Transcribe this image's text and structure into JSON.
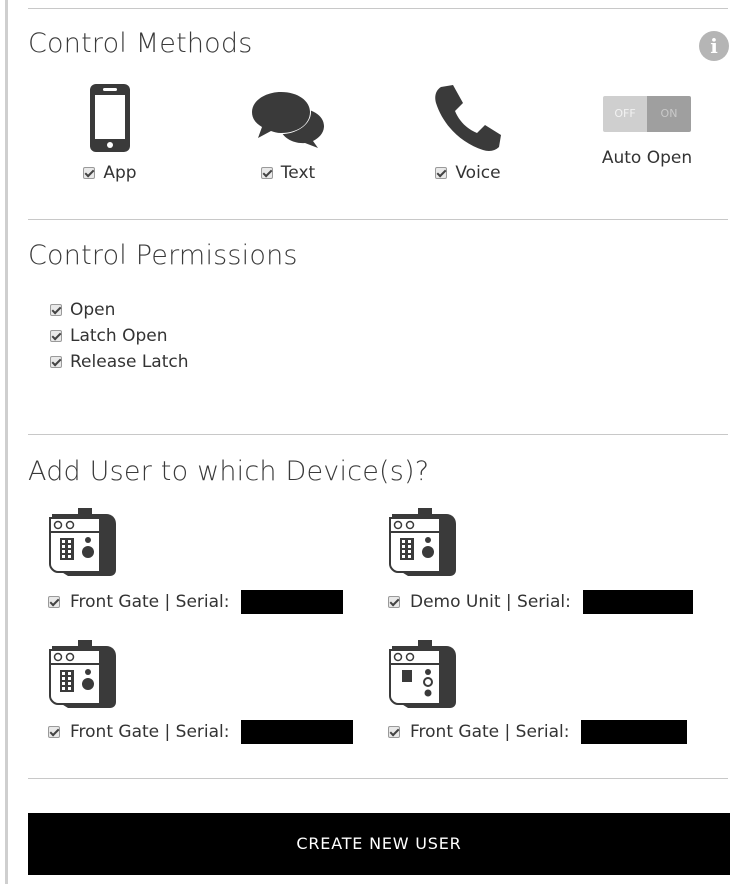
{
  "control_methods": {
    "title": "Control Methods",
    "info_icon": "info-icon",
    "items": [
      {
        "label": "App",
        "icon": "smartphone-icon",
        "checked": true
      },
      {
        "label": "Text",
        "icon": "chat-bubbles-icon",
        "checked": true
      },
      {
        "label": "Voice",
        "icon": "phone-handset-icon",
        "checked": true
      }
    ],
    "auto_open": {
      "label": "Auto Open",
      "off_text": "OFF",
      "on_text": "ON",
      "state": "off"
    }
  },
  "control_permissions": {
    "title": "Control Permissions",
    "items": [
      {
        "label": "Open",
        "checked": true
      },
      {
        "label": "Latch Open",
        "checked": true
      },
      {
        "label": "Release Latch",
        "checked": true
      }
    ]
  },
  "devices": {
    "title": "Add User to which Device(s)?",
    "items": [
      {
        "label": "Front Gate | Serial:",
        "checked": true,
        "icon": "intercom-keypad-icon"
      },
      {
        "label": "Demo Unit | Serial:",
        "checked": true,
        "icon": "intercom-keypad-icon"
      },
      {
        "label": "Front Gate | Serial:",
        "checked": true,
        "icon": "intercom-keypad-icon"
      },
      {
        "label": "Front Gate | Serial:",
        "checked": true,
        "icon": "intercom-buttons-icon"
      }
    ]
  },
  "create_button": {
    "label": "CREATE NEW USER"
  },
  "colors": {
    "button_bg": "#000000",
    "button_text": "#ffffff",
    "divider": "#c8c8c8",
    "icon_gray": "#444444"
  }
}
